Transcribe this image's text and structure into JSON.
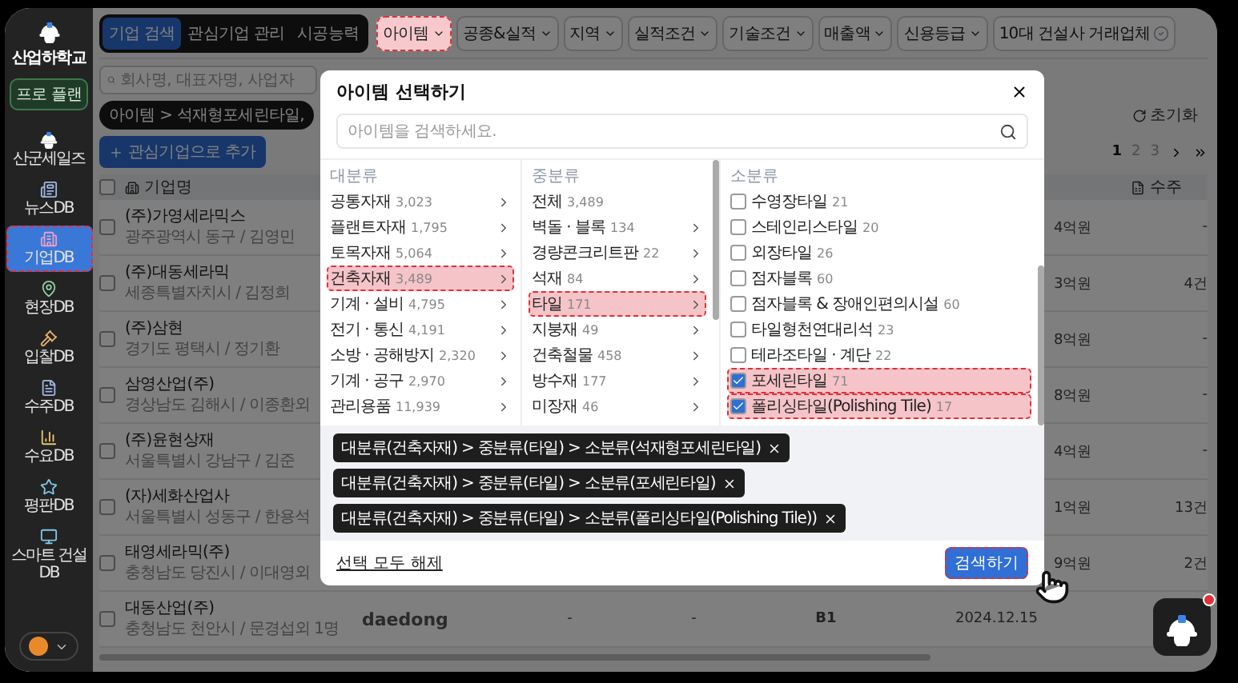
{
  "sidebar": {
    "logo": "산업하학교",
    "plan_button": "프로 플랜",
    "items": [
      {
        "label": "산군세일즈",
        "selected": false,
        "highlighted": false
      },
      {
        "label": "뉴스DB",
        "selected": false,
        "highlighted": false
      },
      {
        "label": "기업DB",
        "selected": true,
        "highlighted": true
      },
      {
        "label": "현장DB",
        "selected": false,
        "highlighted": false
      },
      {
        "label": "입찰DB",
        "selected": false,
        "highlighted": false
      },
      {
        "label": "수주DB",
        "selected": false,
        "highlighted": false
      },
      {
        "label": "수요DB",
        "selected": false,
        "highlighted": false
      },
      {
        "label": "평판DB",
        "selected": false,
        "highlighted": false
      },
      {
        "label": "스마트 건설DB",
        "selected": false,
        "highlighted": false
      }
    ]
  },
  "topbar": {
    "tabs": [
      {
        "label": "기업 검색",
        "selected": true
      },
      {
        "label": "관심기업 관리",
        "selected": false
      },
      {
        "label": "시공능력",
        "selected": false
      }
    ],
    "filters": [
      {
        "label": "아이템",
        "kind": "dropdown",
        "highlighted": true
      },
      {
        "label": "공종&실적",
        "kind": "dropdown",
        "highlighted": false
      },
      {
        "label": "지역",
        "kind": "dropdown",
        "highlighted": false
      },
      {
        "label": "실적조건",
        "kind": "dropdown",
        "highlighted": false
      },
      {
        "label": "기술조건",
        "kind": "dropdown",
        "highlighted": false
      },
      {
        "label": "매출액",
        "kind": "dropdown",
        "highlighted": false
      },
      {
        "label": "신용등급",
        "kind": "dropdown",
        "highlighted": false
      },
      {
        "label": "10대 건설사 거래업체",
        "kind": "toggle",
        "highlighted": false
      }
    ]
  },
  "search": {
    "placeholder": "회사명, 대표자명, 사업자"
  },
  "filter_chip": "아이템 > 석재형포세린타일,",
  "reset": "초기화",
  "add_button": "관심기업으로 추가",
  "pagination": [
    {
      "label": "1",
      "selected": true
    },
    {
      "label": "2",
      "selected": false
    },
    {
      "label": "3",
      "selected": false
    }
  ],
  "table": {
    "header_checked": false,
    "columns": {
      "name": "기업명",
      "orders": "수주"
    },
    "rows": [
      {
        "checked": false,
        "name": "(주)가영세라믹스",
        "address": "광주광역시 동구 / 김영민",
        "amount": "4억원",
        "orders": "-"
      },
      {
        "checked": false,
        "name": "(주)대동세라믹",
        "address": "세종특별자치시 / 김정희",
        "amount": "3억원",
        "orders": "4건"
      },
      {
        "checked": false,
        "name": "(주)삼현",
        "address": "경기도 평택시 / 정기환",
        "amount": "8억원",
        "orders": "-"
      },
      {
        "checked": false,
        "name": "삼영산업(주)",
        "address": "경상남도 김해시 / 이종환외",
        "amount": "8억원",
        "orders": "-"
      },
      {
        "checked": false,
        "name": "(주)윤현상재",
        "address": "서울특별시 강남구 / 김준",
        "amount": "4억원",
        "orders": "-"
      },
      {
        "checked": false,
        "name": "(자)세화산업사",
        "address": "서울특별시 성동구 / 한용석",
        "amount": "1억원",
        "orders": "13건"
      },
      {
        "checked": false,
        "name": "태영세라믹(주)",
        "address": "충청남도 당진시 / 이대영외",
        "amount": "9억원",
        "orders": "2건"
      },
      {
        "checked": false,
        "name": "대동산업(주)",
        "address": "충청남도 천안시 / 문경섭외 1명",
        "extras": {
          "logo": "daedong",
          "column_3": "-",
          "column_4": "-",
          "grade": "B1",
          "date": "2024.12.15"
        }
      }
    ]
  },
  "modal": {
    "title": "아이템 선택하기",
    "search_placeholder": "아이템을 검색하세요.",
    "major": {
      "heading": "대분류",
      "items": [
        {
          "name": "공통자재",
          "count": "3,023",
          "selected": false,
          "expandable": true
        },
        {
          "name": "플랜트자재",
          "count": "1,795",
          "selected": false,
          "expandable": true
        },
        {
          "name": "토목자재",
          "count": "5,064",
          "selected": false,
          "expandable": true
        },
        {
          "name": "건축자재",
          "count": "3,489",
          "selected": true,
          "expandable": true
        },
        {
          "name": "기계 · 설비",
          "count": "4,795",
          "selected": false,
          "expandable": true
        },
        {
          "name": "전기 · 통신",
          "count": "4,191",
          "selected": false,
          "expandable": true
        },
        {
          "name": "소방 · 공해방지",
          "count": "2,320",
          "selected": false,
          "expandable": true
        },
        {
          "name": "기계 · 공구",
          "count": "2,970",
          "selected": false,
          "expandable": true
        },
        {
          "name": "관리용품",
          "count": "11,939",
          "selected": false,
          "expandable": true
        }
      ]
    },
    "middle": {
      "heading": "중분류",
      "items": [
        {
          "name": "전체",
          "count": "3,489",
          "selected": false,
          "expandable": false
        },
        {
          "name": "벽돌 · 블록",
          "count": "134",
          "selected": false,
          "expandable": true
        },
        {
          "name": "경량콘크리트판",
          "count": "22",
          "selected": false,
          "expandable": true
        },
        {
          "name": "석재",
          "count": "84",
          "selected": false,
          "expandable": true
        },
        {
          "name": "타일",
          "count": "171",
          "selected": true,
          "expandable": true
        },
        {
          "name": "지붕재",
          "count": "49",
          "selected": false,
          "expandable": true
        },
        {
          "name": "건축철물",
          "count": "458",
          "selected": false,
          "expandable": true
        },
        {
          "name": "방수재",
          "count": "177",
          "selected": false,
          "expandable": true
        },
        {
          "name": "미장재",
          "count": "46",
          "selected": false,
          "expandable": true
        }
      ]
    },
    "minor": {
      "heading": "소분류",
      "items": [
        {
          "name": "수영장타일",
          "count": "21",
          "checked": false
        },
        {
          "name": "스테인리스타일",
          "count": "20",
          "checked": false
        },
        {
          "name": "외장타일",
          "count": "26",
          "checked": false
        },
        {
          "name": "점자블록",
          "count": "60",
          "checked": false
        },
        {
          "name": "점자블록 & 장애인편의시설",
          "count": "60",
          "checked": false
        },
        {
          "name": "타일형천연대리석",
          "count": "23",
          "checked": false
        },
        {
          "name": "테라조타일 · 계단",
          "count": "22",
          "checked": false
        },
        {
          "name": "포세린타일",
          "count": "71",
          "checked": true
        },
        {
          "name": "폴리싱타일(Polishing Tile)",
          "count": "17",
          "checked": true
        }
      ]
    },
    "chips": [
      "대분류(건축자재) > 중분류(타일) > 소분류(석재형포세린타일)",
      "대분류(건축자재) > 중분류(타일) > 소분류(포세린타일)",
      "대분류(건축자재) > 중분류(타일) > 소분류(폴리싱타일(Polishing Tile))"
    ],
    "clear_all": "선택 모두 해제",
    "submit": {
      "label": "검색하기",
      "highlighted": true
    }
  },
  "chat_button": {
    "notification": true
  }
}
